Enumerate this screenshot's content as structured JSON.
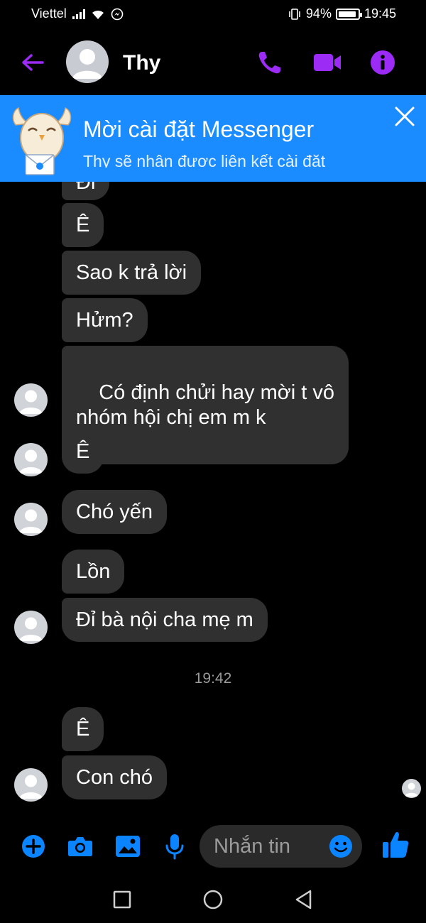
{
  "status_bar": {
    "carrier": "Viettel",
    "battery_percent": "94%",
    "battery_level": 0.94,
    "time": "19:45"
  },
  "header": {
    "contact_name": "Thy",
    "icons": [
      "back-arrow-icon",
      "phone-icon",
      "video-camera-icon",
      "info-icon"
    ],
    "accent_color": "#9b2bf5"
  },
  "banner": {
    "title": "Mời cài đặt Messenger",
    "subtitle": "Thy sẽ nhận được liên kết cài đặt",
    "background_color": "#1a8cff"
  },
  "messages": [
    {
      "text": "Đi",
      "partial": true
    },
    {
      "text": "Ê"
    },
    {
      "text": "Sao k trả lời"
    },
    {
      "text": "Hửm?"
    },
    {
      "text": "Có định chửi hay mời t vô\nnhóm hội chị em m k"
    },
    {
      "text": "Ê"
    },
    {
      "text": "Chó yến"
    },
    {
      "text": "Lồn"
    },
    {
      "text": "Đỉ bà nội cha mẹ m"
    },
    {
      "text": "Ê"
    },
    {
      "text": "Con chó"
    }
  ],
  "timestamp": "19:42",
  "composer": {
    "placeholder": "Nhắn tin",
    "icons": [
      "plus-icon",
      "camera-icon",
      "image-icon",
      "microphone-icon",
      "emoji-icon",
      "thumbs-up-icon"
    ],
    "accent_color": "#0a84ff"
  },
  "nav_bar": {
    "icons": [
      "recents-square-icon",
      "home-circle-icon",
      "back-triangle-icon"
    ]
  }
}
